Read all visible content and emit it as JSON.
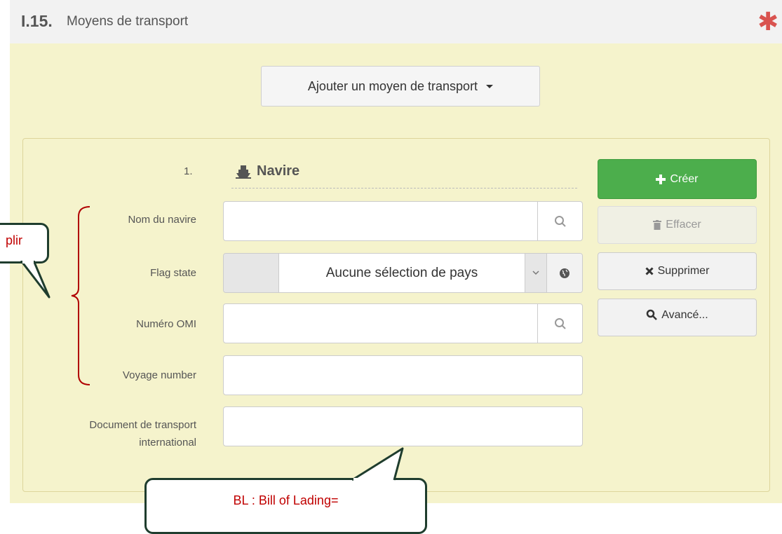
{
  "section": {
    "code": "I.15.",
    "title": "Moyens de transport",
    "required_mark": "✱"
  },
  "add_transport": {
    "label": "Ajouter un moyen de transport"
  },
  "transport": {
    "index": "1.",
    "type_label": "Navire",
    "type_icon": "ship-icon"
  },
  "fields": {
    "ship_name": {
      "label": "Nom du navire",
      "value": "",
      "placeholder": ""
    },
    "flag_state": {
      "label": "Flag state",
      "selected": "Aucune sélection de pays"
    },
    "imo_number": {
      "label": "Numéro OMI",
      "value": "",
      "placeholder": ""
    },
    "voyage_number": {
      "label": "Voyage number",
      "value": "",
      "placeholder": ""
    },
    "transport_doc": {
      "label_line1": "Document de transport",
      "label_line2": "international",
      "value": "",
      "placeholder": ""
    }
  },
  "actions": {
    "create": "Créer",
    "clear": "Effacer",
    "delete": "Supprimer",
    "advanced": "Avancé..."
  },
  "annotations": {
    "left_callout": "plir",
    "bottom_callout": "BL : Bill of Lading="
  },
  "colors": {
    "panel_yellow": "#f5f3cc",
    "create_green": "#4cae4c",
    "required_red": "#d9534f",
    "annotation_red": "#c00000"
  }
}
